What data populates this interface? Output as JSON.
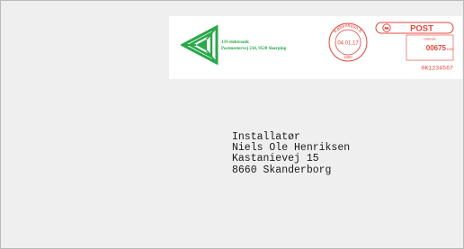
{
  "sender": {
    "company": "JJS elektronik",
    "address": "Postmestervej 234, 9520 Skørping"
  },
  "postmark": {
    "city": "København K",
    "date": "04.01.17",
    "postal_code": "1000"
  },
  "franking": {
    "carrier": "POST",
    "subtext": "Danmark",
    "amount": "00675",
    "currency": "DKK",
    "meter_id": "0K1234567"
  },
  "recipient": {
    "line1": "Installatør",
    "line2": "Niels Ole Henriksen",
    "line3": "Kastanievej 15",
    "line4": "8660 Skanderborg"
  },
  "colors": {
    "brand_green": "#2aa84a",
    "postmark_red": "#e0443a"
  }
}
